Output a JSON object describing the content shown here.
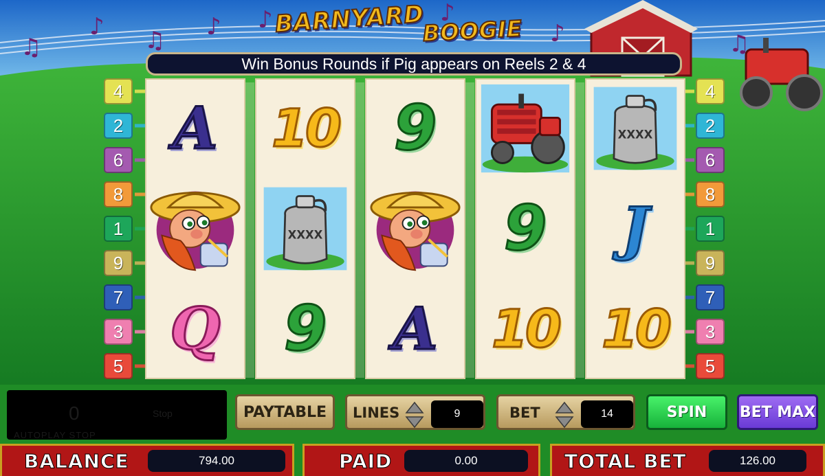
{
  "game": {
    "title_word1": "BARNYARD",
    "title_word2": "BOOGIE",
    "banner": "Win Bonus Rounds if Pig appears on Reels 2 & 4"
  },
  "paylines": {
    "left": [
      "4",
      "2",
      "6",
      "8",
      "1",
      "9",
      "7",
      "3",
      "5"
    ],
    "right": [
      "4",
      "2",
      "6",
      "8",
      "1",
      "9",
      "7",
      "3",
      "5"
    ],
    "colors": [
      "#e4e253",
      "#2fb6d6",
      "#a45ab0",
      "#f29a3a",
      "#1da65a",
      "#c9b45a",
      "#2f5fb8",
      "#ef7fb0",
      "#e94a3a"
    ]
  },
  "reels": [
    [
      {
        "symbol": "A",
        "type": "letter"
      },
      {
        "symbol": "farmer",
        "type": "image"
      },
      {
        "symbol": "Q",
        "type": "letter"
      }
    ],
    [
      {
        "symbol": "10",
        "type": "number"
      },
      {
        "symbol": "XXXX",
        "type": "jug"
      },
      {
        "symbol": "9",
        "type": "number"
      }
    ],
    [
      {
        "symbol": "9",
        "type": "number"
      },
      {
        "symbol": "farmer",
        "type": "image"
      },
      {
        "symbol": "A",
        "type": "letter"
      }
    ],
    [
      {
        "symbol": "tractor",
        "type": "image"
      },
      {
        "symbol": "9",
        "type": "number"
      },
      {
        "symbol": "10",
        "type": "number"
      }
    ],
    [
      {
        "symbol": "XXXX",
        "type": "jug"
      },
      {
        "symbol": "J",
        "type": "letter"
      },
      {
        "symbol": "10",
        "type": "number"
      }
    ]
  ],
  "controls": {
    "autoplay_count": "0",
    "autoplay_stop": "Stop",
    "autoplay_hint": "AUTOPLAY STOP",
    "paytable_label": "PAYTABLE",
    "lines_label": "LINES",
    "lines_value": "9",
    "bet_label": "BET",
    "bet_value": "14",
    "spin_label": "SPIN",
    "betmax_label": "BET MAX"
  },
  "status": {
    "balance_label": "BALANCE",
    "balance_value": "794.00",
    "paid_label": "PAID",
    "paid_value": "0.00",
    "totalbet_label": "TOTAL BET",
    "totalbet_value": "126.00"
  },
  "colors": {
    "sky": "#2b8ad6",
    "grass": "#1e8f2a",
    "barn": "#c0282d",
    "status_bar": "#b11616",
    "spin": "#17b23a",
    "bet_max": "#6a3ad6"
  }
}
